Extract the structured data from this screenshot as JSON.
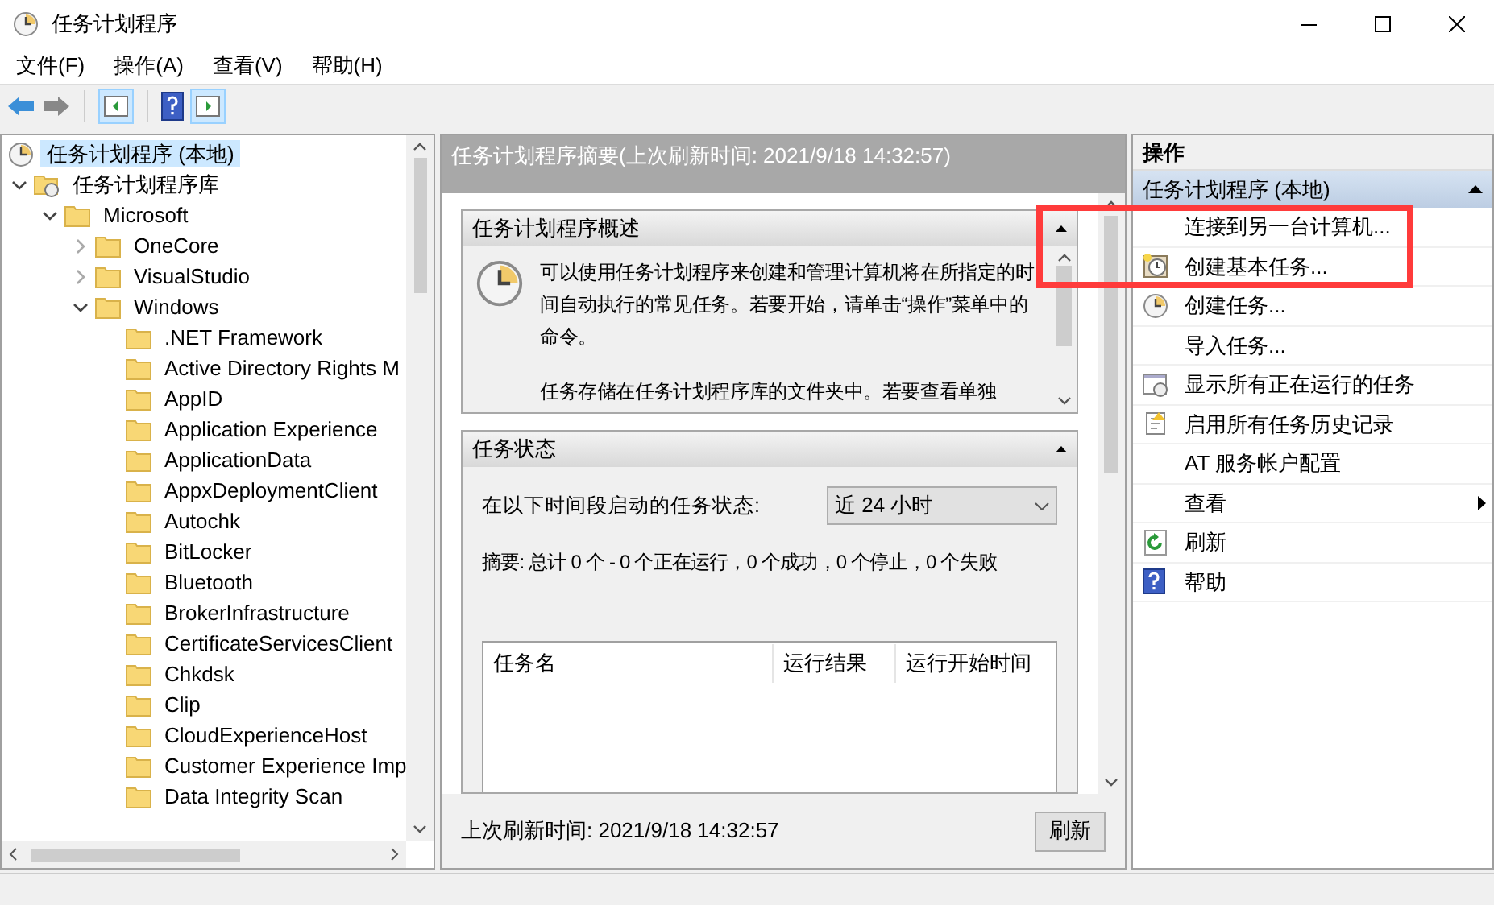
{
  "window": {
    "title": "任务计划程序"
  },
  "menu": [
    "文件(F)",
    "操作(A)",
    "查看(V)",
    "帮助(H)"
  ],
  "tree": {
    "label": "任务计划程序 (本地)",
    "selected": true,
    "children": [
      {
        "label": "任务计划程序库",
        "selected": false,
        "expanded": true,
        "children": [
          {
            "label": "Microsoft",
            "selected": false,
            "expanded": true,
            "children": [
              {
                "label": "OneCore",
                "selected": false,
                "expanded": false
              },
              {
                "label": "VisualStudio",
                "selected": false,
                "expanded": false
              },
              {
                "label": "Windows",
                "selected": false,
                "expanded": true,
                "children": [
                  {
                    "label": ".NET Framework",
                    "selected": false
                  },
                  {
                    "label": "Active Directory Rights M",
                    "selected": false
                  },
                  {
                    "label": "AppID",
                    "selected": false
                  },
                  {
                    "label": "Application Experience",
                    "selected": false
                  },
                  {
                    "label": "ApplicationData",
                    "selected": false
                  },
                  {
                    "label": "AppxDeploymentClient",
                    "selected": false
                  },
                  {
                    "label": "Autochk",
                    "selected": false
                  },
                  {
                    "label": "BitLocker",
                    "selected": false
                  },
                  {
                    "label": "Bluetooth",
                    "selected": false
                  },
                  {
                    "label": "BrokerInfrastructure",
                    "selected": false
                  },
                  {
                    "label": "CertificateServicesClient",
                    "selected": false
                  },
                  {
                    "label": "Chkdsk",
                    "selected": false
                  },
                  {
                    "label": "Clip",
                    "selected": false
                  },
                  {
                    "label": "CloudExperienceHost",
                    "selected": false
                  },
                  {
                    "label": "Customer Experience Imp",
                    "selected": false
                  },
                  {
                    "label": "Data Integrity Scan",
                    "selected": false
                  }
                ]
              }
            ]
          }
        ]
      }
    ]
  },
  "summary": {
    "header": "任务计划程序摘要(上次刷新时间: 2021/9/18 14:32:57)",
    "overview": {
      "title": "任务计划程序概述",
      "expanded": true,
      "paragraphs": [
        "可以使用任务计划程序来创建和管理计算机将在所指定的时间自动执行的常见任务。若要开始，请单击“操作”菜单中的命令。",
        "任务存储在任务计划程序库的文件夹中。若要查看单独"
      ]
    },
    "status": {
      "title": "任务状态",
      "expanded": true,
      "period_label": "在以下时间段启动的任务状态:",
      "period_value": "近 24 小时",
      "summary": "摘要: 总计 0 个 - 0 个正在运行，0 个成功，0 个停止，0 个失败",
      "columns": [
        "任务名",
        "运行结果",
        "运行开始时间"
      ]
    },
    "footer": "上次刷新时间: 2021/9/18 14:32:57",
    "refresh_button": "刷新"
  },
  "actions": {
    "header": "操作",
    "group": {
      "title": "任务计划程序 (本地)",
      "expanded": true
    },
    "items": [
      {
        "label": "连接到另一台计算机...",
        "kind": "action"
      },
      {
        "label": "创建基本任务...",
        "kind": "action"
      },
      {
        "label": "创建任务...",
        "kind": "action"
      },
      {
        "label": "导入任务...",
        "kind": "action"
      },
      {
        "label": "显示所有正在运行的任务",
        "kind": "action"
      },
      {
        "label": "启用所有任务历史记录",
        "kind": "action"
      },
      {
        "label": "AT 服务帐户配置",
        "kind": "action"
      },
      {
        "label": "查看",
        "kind": "submenu"
      },
      {
        "label": "刷新",
        "kind": "action"
      },
      {
        "label": "帮助",
        "kind": "action"
      }
    ]
  }
}
